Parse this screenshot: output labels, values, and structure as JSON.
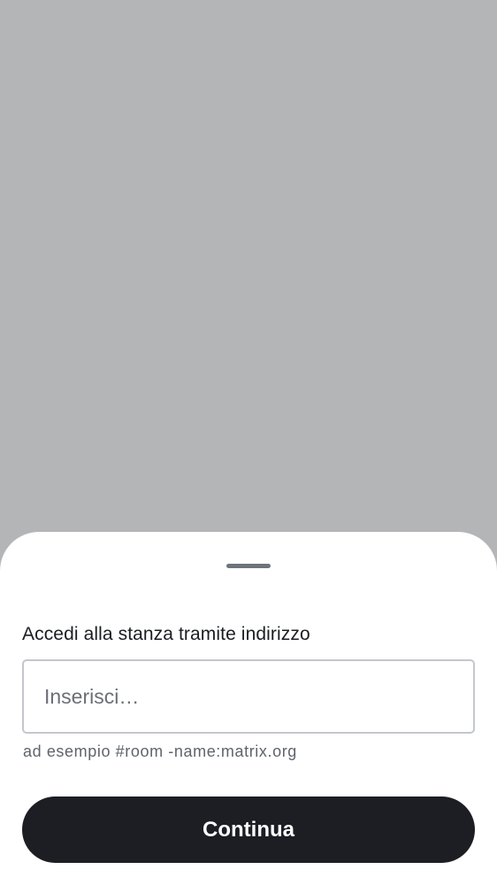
{
  "sheet": {
    "title": "Accedi alla stanza tramite indirizzo",
    "address_input": {
      "value": "",
      "placeholder": "Inserisci…"
    },
    "hint": "ad esempio #room -name:matrix.org",
    "continue_label": "Continua"
  },
  "colors": {
    "scrim": "#b4b5b7",
    "sheet_background": "#ffffff",
    "handle": "#6f747b",
    "button_background": "#1c1e23",
    "button_text": "#ffffff",
    "input_border": "#c4c7cc",
    "text_primary": "#1b1d22",
    "text_secondary": "#5f646b"
  }
}
